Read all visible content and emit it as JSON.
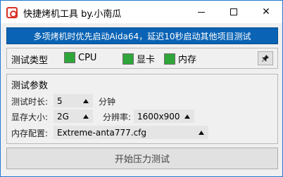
{
  "window": {
    "title": "快捷烤机工具 by.小南瓜",
    "buttons": {
      "minimize": "minimize-icon",
      "maximize": "maximize-icon",
      "close": "✕"
    }
  },
  "banner": {
    "text": "多项烤机时优先启动Aida64，延迟10秒启动其他项目测试",
    "bg_color": "#0a63b4"
  },
  "test_type": {
    "label": "测试类型",
    "options": [
      {
        "label": "CPU",
        "checked": true,
        "color": "#2fa63a"
      },
      {
        "label": "显卡",
        "checked": true,
        "color": "#2fa63a"
      },
      {
        "label": "内存",
        "checked": true,
        "color": "#2fa63a"
      }
    ],
    "pin_icon": "pin-icon"
  },
  "params": {
    "title": "测试参数",
    "duration": {
      "label": "测试时长:",
      "value": "5",
      "unit": "分钟"
    },
    "vram": {
      "label": "显存大小:",
      "value": "2G"
    },
    "resolution": {
      "label": "分辨率:",
      "value": "1600x900"
    },
    "mem_config": {
      "label": "内存配置:",
      "value": "Extreme-anta777.cfg"
    }
  },
  "start_button": {
    "label": "开始压力测试"
  }
}
